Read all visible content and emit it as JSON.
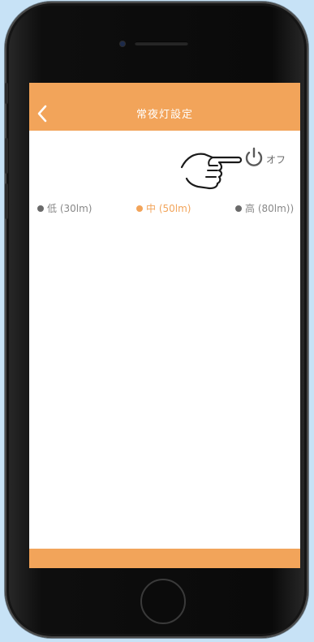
{
  "header": {
    "title": "常夜灯設定"
  },
  "power": {
    "state_label": "オフ",
    "icon": "power-icon",
    "hint_icon": "pointing-hand-icon"
  },
  "levels": [
    {
      "label": "低 (30lm)",
      "active": false
    },
    {
      "label": "中 (50lm)",
      "active": true
    },
    {
      "label": "高 (80lm))",
      "active": false
    }
  ],
  "colors": {
    "accent": "#f2a45a",
    "inactive": "#6a6a6a",
    "background": "#c7e2f6"
  }
}
